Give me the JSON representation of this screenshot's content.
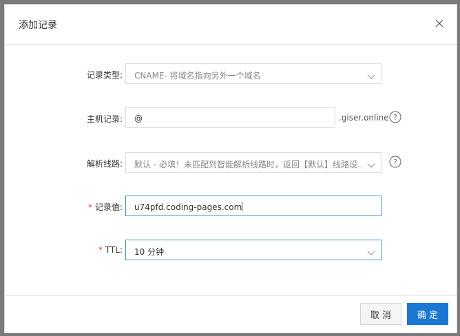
{
  "dialog": {
    "title": "添加记录",
    "close_icon": "close-icon"
  },
  "form": {
    "record_type": {
      "label": "记录类型:",
      "value": "CNAME- 将域名指向另外一个域名"
    },
    "host": {
      "label": "主机记录:",
      "value": "@",
      "suffix": ".giser.online"
    },
    "line": {
      "label": "解析线路:",
      "value": "默认 - 必填！未匹配到智能解析线路时，返回【默认】线路设..."
    },
    "record_value": {
      "required_mark": "*",
      "label": "记录值:",
      "value": "u74pfd.coding-pages.com"
    },
    "ttl": {
      "required_mark": "*",
      "label": "TTL:",
      "value": "10 分钟"
    }
  },
  "footer": {
    "cancel_label": "取 消",
    "ok_label": "确 定"
  },
  "colors": {
    "primary": "#1a78d4",
    "required": "#e03c3c",
    "focus_border": "#3b8ed8"
  }
}
